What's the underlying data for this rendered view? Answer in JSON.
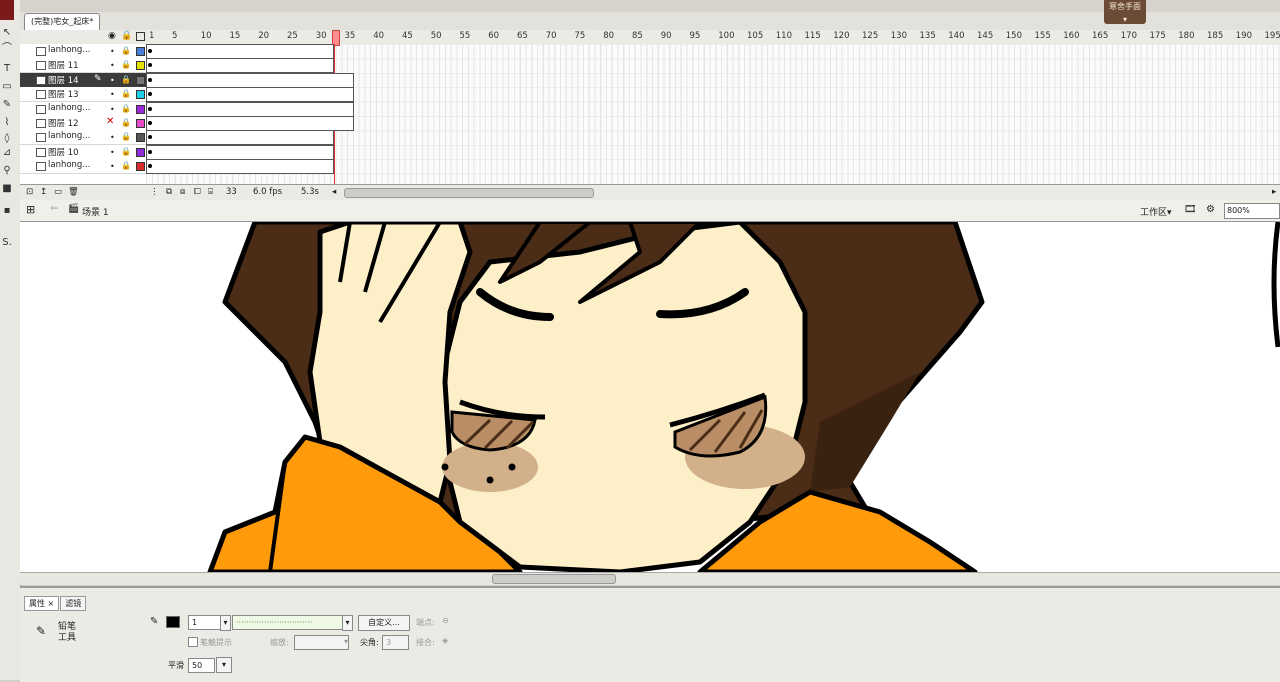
{
  "document": {
    "tab_title": "(完整)宅女_起床*",
    "close_symbol": "×"
  },
  "corner_button": {
    "label": "寒舍手面",
    "sub": "▾"
  },
  "timeline": {
    "ruler": [
      "1",
      "5",
      "10",
      "15",
      "20",
      "25",
      "30",
      "35",
      "40",
      "45",
      "50",
      "55",
      "60",
      "65",
      "70",
      "75",
      "80",
      "85",
      "90",
      "95",
      "100",
      "105",
      "110",
      "115",
      "120",
      "125",
      "130",
      "135",
      "140",
      "145",
      "150",
      "155",
      "160",
      "165",
      "170",
      "175",
      "180",
      "185",
      "190",
      "195"
    ],
    "layers": [
      {
        "name": "lanhong...",
        "color": "#4a7bd6"
      },
      {
        "name": "图层 11",
        "color": "#e6e000"
      },
      {
        "name": "图层 14",
        "color": "#777777",
        "selected": true
      },
      {
        "name": "图层 13",
        "color": "#1ecde6"
      },
      {
        "name": "lanhong...",
        "color": "#9b2bd6"
      },
      {
        "name": "图层 12",
        "color": "#e64bc8",
        "hidden": true
      },
      {
        "name": "lanhong...",
        "color": "#555555"
      },
      {
        "name": "图层 10",
        "color": "#8a2bd6"
      },
      {
        "name": "lanhong...",
        "color": "#d62b2b"
      }
    ],
    "status": {
      "current_frame": "33",
      "fps": "6.0 fps",
      "time": "5.3s"
    }
  },
  "edit_bar": {
    "scene": "场景 1",
    "workspace": "工作区▾",
    "zoom": "800%"
  },
  "properties": {
    "tabs": [
      "属性",
      "滤镜"
    ],
    "tool_name": "铅笔工具",
    "stroke_size": "1",
    "custom_button": "自定义...",
    "cap_label": "端点:",
    "hinting_label": "笔触提示",
    "scale_label": "缩放:",
    "miter_label": "尖角:",
    "miter_value": "3",
    "join_label": "接合:",
    "smooth_label": "平滑",
    "smooth_value": "50"
  },
  "colors": {
    "hair": "#4b2c16",
    "skin": "#fdf0c8",
    "shirt": "#ff9a0a",
    "blush": "#d2b08a"
  }
}
